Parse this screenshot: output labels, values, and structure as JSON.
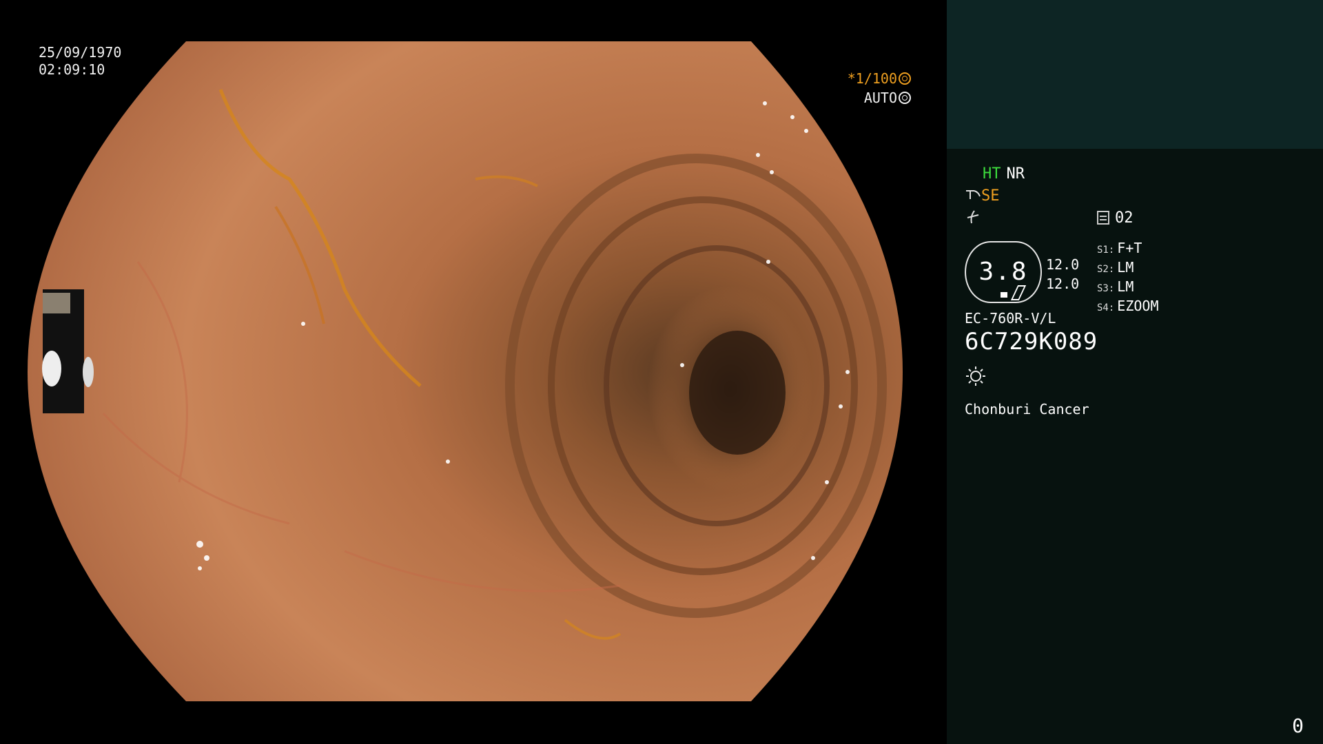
{
  "overlay": {
    "date": "25/09/1970",
    "time": "02:09:10",
    "shutter": "*1/100",
    "auto": "AUTO"
  },
  "panel": {
    "ht": "HT",
    "nr": "NR",
    "se": "SE",
    "mode_number": "02",
    "gauge_value": "3.8",
    "side_values": [
      "12.0",
      "12.0"
    ],
    "settings": [
      {
        "key": "S1:",
        "value": "F+T"
      },
      {
        "key": "S2:",
        "value": "LM"
      },
      {
        "key": "S3:",
        "value": "LM"
      },
      {
        "key": "S4:",
        "value": "EZOOM"
      }
    ],
    "model": "EC-760R-V/L",
    "serial": "6C729K089",
    "note": "Chonburi Cancer",
    "counter": "0"
  },
  "colors": {
    "ht_green": "#3ddc3d",
    "accent_orange": "#f0a020",
    "panel_top": "#0d2524",
    "panel_bg": "#07120f"
  }
}
